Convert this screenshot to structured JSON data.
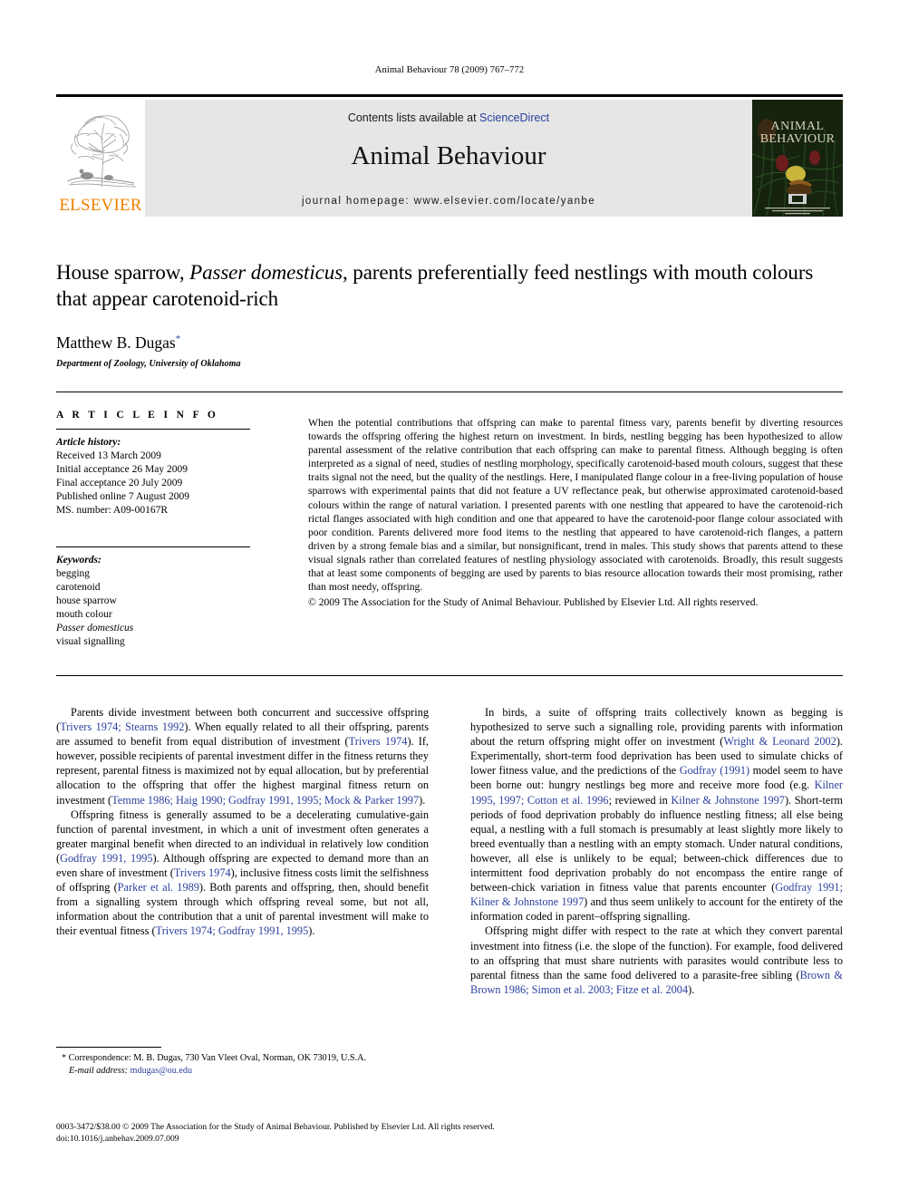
{
  "running_head": "Animal Behaviour 78 (2009) 767–772",
  "masthead": {
    "publisher_name": "ELSEVIER",
    "contents_prefix": "Contents lists available at ",
    "contents_link": "ScienceDirect",
    "journal_title": "Animal Behaviour",
    "homepage_label": "journal homepage: www.elsevier.com/locate/yanbe",
    "cover_title_line1": "ANIMAL",
    "cover_title_line2": "BEHAVIOUR"
  },
  "title_block": {
    "title_part1": "House sparrow, ",
    "title_italic": "Passer domesticus",
    "title_part2": ", parents preferentially feed nestlings with mouth colours that appear carotenoid-rich",
    "author": "Matthew B. Dugas",
    "author_marker": "*",
    "affiliation": "Department of Zoology, University of Oklahoma"
  },
  "article_info": {
    "heading": "A R T I C L E  I N F O",
    "history_label": "Article history:",
    "history": [
      "Received 13 March 2009",
      "Initial acceptance 26 May 2009",
      "Final acceptance 20 July 2009",
      "Published online 7 August 2009",
      "MS. number: A09-00167R"
    ],
    "keywords_label": "Keywords:",
    "keywords": [
      "begging",
      "carotenoid",
      "house sparrow",
      "mouth colour",
      "Passer domesticus",
      "visual signalling"
    ],
    "keywords_italic_index": 4
  },
  "abstract": {
    "text": "When the potential contributions that offspring can make to parental fitness vary, parents benefit by diverting resources towards the offspring offering the highest return on investment. In birds, nestling begging has been hypothesized to allow parental assessment of the relative contribution that each offspring can make to parental fitness. Although begging is often interpreted as a signal of need, studies of nestling morphology, specifically carotenoid-based mouth colours, suggest that these traits signal not the need, but the quality of the nestlings. Here, I manipulated flange colour in a free-living population of house sparrows with experimental paints that did not feature a UV reflectance peak, but otherwise approximated carotenoid-based colours within the range of natural variation. I presented parents with one nestling that appeared to have the carotenoid-rich rictal flanges associated with high condition and one that appeared to have the carotenoid-poor flange colour associated with poor condition. Parents delivered more food items to the nestling that appeared to have carotenoid-rich flanges, a pattern driven by a strong female bias and a similar, but nonsignificant, trend in males. This study shows that parents attend to these visual signals rather than correlated features of nestling physiology associated with carotenoids. Broadly, this result suggests that at least some components of begging are used by parents to bias resource allocation towards their most promising, rather than most needy, offspring.",
    "copyright": "© 2009 The Association for the Study of Animal Behaviour. Published by Elsevier Ltd. All rights reserved."
  },
  "body": {
    "left_column": [
      {
        "segments": [
          {
            "t": "Parents divide investment between both concurrent and successive offspring (",
            "r": false
          },
          {
            "t": "Trivers 1974; Stearns 1992",
            "r": true
          },
          {
            "t": "). When equally related to all their offspring, parents are assumed to benefit from equal distribution of investment (",
            "r": false
          },
          {
            "t": "Trivers 1974",
            "r": true
          },
          {
            "t": "). If, however, possible recipients of parental investment differ in the fitness returns they represent, parental fitness is maximized not by equal allocation, but by preferential allocation to the offspring that offer the highest marginal fitness return on investment (",
            "r": false
          },
          {
            "t": "Temme 1986; Haig 1990; Godfray 1991, 1995; Mock & Parker 1997",
            "r": true
          },
          {
            "t": ").",
            "r": false
          }
        ]
      },
      {
        "segments": [
          {
            "t": "Offspring fitness is generally assumed to be a decelerating cumulative-gain function of parental investment, in which a unit of investment often generates a greater marginal benefit when directed to an individual in relatively low condition (",
            "r": false
          },
          {
            "t": "Godfray 1991, 1995",
            "r": true
          },
          {
            "t": "). Although offspring are expected to demand more than an even share of investment (",
            "r": false
          },
          {
            "t": "Trivers 1974",
            "r": true
          },
          {
            "t": "), inclusive fitness costs limit the selfishness of offspring (",
            "r": false
          },
          {
            "t": "Parker et al. 1989",
            "r": true
          },
          {
            "t": "). Both parents and offspring, then, should benefit from a signalling system through which offspring reveal some, but not all, information about the contribution that a unit of parental investment will make to their eventual fitness (",
            "r": false
          },
          {
            "t": "Trivers 1974; Godfray 1991, 1995",
            "r": true
          },
          {
            "t": ").",
            "r": false
          }
        ]
      }
    ],
    "right_column": [
      {
        "segments": [
          {
            "t": "In birds, a suite of offspring traits collectively known as begging is hypothesized to serve such a signalling role, providing parents with information about the return offspring might offer on investment (",
            "r": false
          },
          {
            "t": "Wright & Leonard 2002",
            "r": true
          },
          {
            "t": "). Experimentally, short-term food deprivation has been used to simulate chicks of lower fitness value, and the predictions of the ",
            "r": false
          },
          {
            "t": "Godfray (1991)",
            "r": true
          },
          {
            "t": " model seem to have been borne out: hungry nestlings beg more and receive more food (e.g. ",
            "r": false
          },
          {
            "t": "Kilner 1995, 1997; Cotton et al. 1996",
            "r": true
          },
          {
            "t": "; reviewed in ",
            "r": false
          },
          {
            "t": "Kilner & Johnstone 1997",
            "r": true
          },
          {
            "t": "). Short-term periods of food deprivation probably do influence nestling fitness; all else being equal, a nestling with a full stomach is presumably at least slightly more likely to breed eventually than a nestling with an empty stomach. Under natural conditions, however, all else is unlikely to be equal; between-chick differences due to intermittent food deprivation probably do not encompass the entire range of between-chick variation in fitness value that parents encounter (",
            "r": false
          },
          {
            "t": "Godfray 1991; Kilner & Johnstone 1997",
            "r": true
          },
          {
            "t": ") and thus seem unlikely to account for the entirety of the information coded in parent–offspring signalling.",
            "r": false
          }
        ]
      },
      {
        "segments": [
          {
            "t": "Offspring might differ with respect to the rate at which they convert parental investment into fitness (i.e. the slope of the function). For example, food delivered to an offspring that must share nutrients with parasites would contribute less to parental fitness than the same food delivered to a parasite-free sibling (",
            "r": false
          },
          {
            "t": "Brown & Brown 1986; Simon et al. 2003; Fitze et al. 2004",
            "r": true
          },
          {
            "t": ").",
            "r": false
          }
        ]
      }
    ]
  },
  "footnote": {
    "marker": "*",
    "correspondence": "Correspondence: M. B. Dugas, 730 Van Vleet Oval, Norman, OK 73019, U.S.A.",
    "email_label": "E-mail address:",
    "email": "mdugas@ou.edu"
  },
  "page_footer": {
    "line1": "0003-3472/$38.00 © 2009 The Association for the Study of Animal Behaviour. Published by Elsevier Ltd. All rights reserved.",
    "line2": "doi:10.1016/j.anbehav.2009.07.009"
  },
  "colors": {
    "reference_link": "#2b3f9e",
    "elsevier_orange": "#F08000",
    "band_grey": "#e6e6e6"
  }
}
